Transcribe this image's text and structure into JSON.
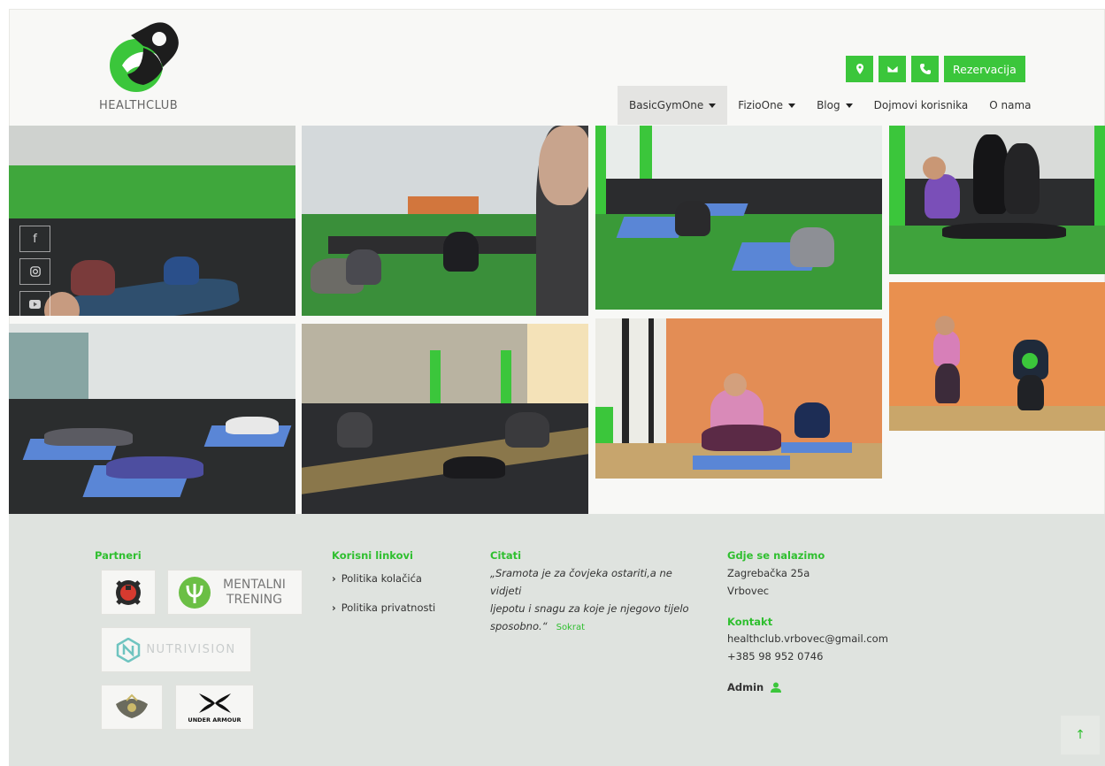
{
  "brand": {
    "name": "HEALTHCLUB",
    "accent": "#3bc63b"
  },
  "top_buttons": {
    "location_icon": "map-marker-icon",
    "mail_icon": "envelope-icon",
    "phone_icon": "phone-icon",
    "reserve_label": "Rezervacija"
  },
  "nav": [
    {
      "label": "BasicGymOne",
      "dropdown": true
    },
    {
      "label": "FizioOne",
      "dropdown": true
    },
    {
      "label": "Blog",
      "dropdown": true
    },
    {
      "label": "Dojmovi korisnika",
      "dropdown": false
    },
    {
      "label": "O nama",
      "dropdown": false
    }
  ],
  "social": [
    "facebook-icon",
    "instagram-icon",
    "youtube-icon"
  ],
  "footer": {
    "partners": {
      "title": "Partneri",
      "logos": [
        "MENTALNI",
        "TRENING",
        "NUTRIVISION",
        "UNDER ARMOUR"
      ]
    },
    "links": {
      "title": "Korisni linkovi",
      "items": [
        "Politika kolačića",
        "Politika privatnosti"
      ]
    },
    "quote": {
      "title": "Citati",
      "line1": "„Sramota je za čovjeka ostariti,a ne vidjeti",
      "line2": "ljepotu i snagu za koje je njegovo tijelo",
      "line3": "sposobno.“",
      "author": "Sokrat"
    },
    "location": {
      "title": "Gdje se nalazimo",
      "street": "Zagrebačka 25a",
      "city": "Vrbovec"
    },
    "contact": {
      "title": "Kontakt",
      "email": "healthclub.vrbovec@gmail.com",
      "phone": "+385 98 952 0746"
    },
    "admin": "Admin"
  },
  "scroll_top": "↑"
}
